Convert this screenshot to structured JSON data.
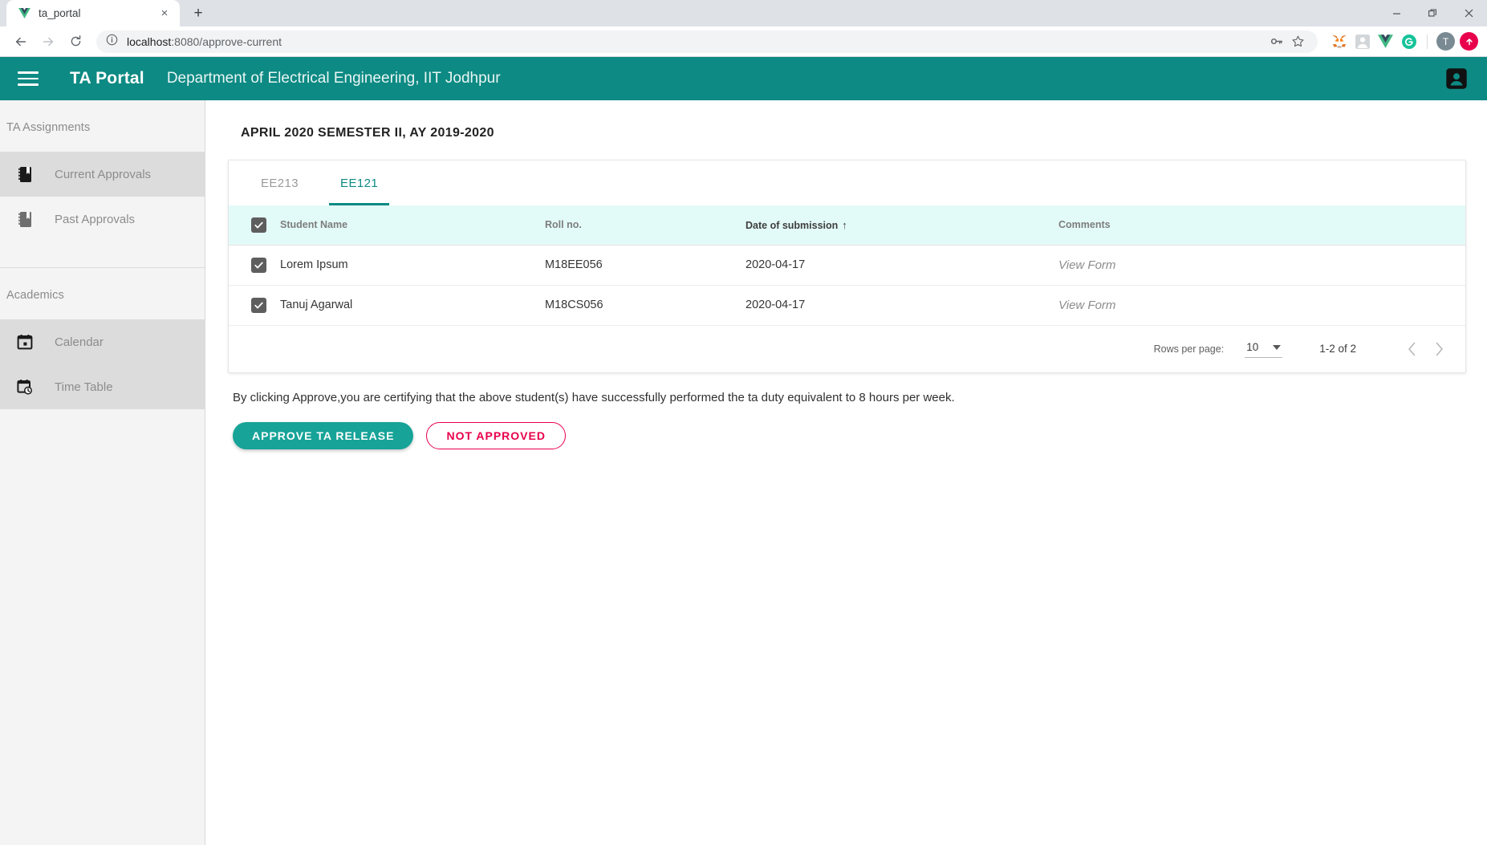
{
  "browser": {
    "tab": {
      "title": "ta_portal",
      "favicon": "vue-logo-icon",
      "close": "×"
    },
    "new_tab_label": "+",
    "window_controls": {
      "minimize": "minimize-icon",
      "maximize": "restore-icon",
      "close": "close-icon"
    },
    "nav": {
      "back": "back-arrow-icon",
      "forward": "forward-arrow-icon",
      "reload": "reload-icon"
    },
    "omnibox": {
      "info_icon": "site-info-icon",
      "url_host": "localhost",
      "url_path": ":8080/approve-current",
      "password_icon": "key-icon",
      "bookmark_icon": "star-icon"
    },
    "extensions": [
      {
        "name": "metamask-icon"
      },
      {
        "name": "extension-icon"
      },
      {
        "name": "vue-devtools-icon"
      },
      {
        "name": "grammarly-icon"
      }
    ],
    "profile_initial": "T",
    "update_icon": "update-arrow-icon"
  },
  "appbar": {
    "menu_icon": "hamburger-menu-icon",
    "title": "TA Portal",
    "subtitle": "Department of Electrical Engineering, IIT Jodhpur",
    "account_icon": "account-box-icon",
    "color": "#0d8a83"
  },
  "sidebar": {
    "sections": [
      {
        "label": "TA Assignments",
        "items": [
          {
            "label": "Current Approvals",
            "icon": "book-bookmark-icon",
            "active": true
          },
          {
            "label": "Past Approvals",
            "icon": "book-bookmark-icon",
            "active": false
          }
        ]
      },
      {
        "label": "Academics",
        "items": [
          {
            "label": "Calendar",
            "icon": "calendar-icon",
            "active": true
          },
          {
            "label": "Time Table",
            "icon": "calendar-clock-icon",
            "active": true
          }
        ]
      }
    ]
  },
  "main": {
    "page_title": "APRIL 2020 SEMESTER II, AY 2019-2020",
    "tabs": [
      {
        "label": "EE213",
        "active": false
      },
      {
        "label": "EE121",
        "active": true
      }
    ],
    "table": {
      "select_all_checked": true,
      "columns": [
        {
          "key": "name",
          "label": "Student Name",
          "sorted": false
        },
        {
          "key": "roll",
          "label": "Roll no.",
          "sorted": false
        },
        {
          "key": "date",
          "label": "Date of submission",
          "sorted": true,
          "sort_arrow": "↑"
        },
        {
          "key": "comments",
          "label": "Comments",
          "sorted": false
        }
      ],
      "rows": [
        {
          "checked": true,
          "name": "Lorem Ipsum",
          "roll": "M18EE056",
          "date": "2020-04-17",
          "comments": "View Form"
        },
        {
          "checked": true,
          "name": "Tanuj Agarwal",
          "roll": "M18CS056",
          "date": "2020-04-17",
          "comments": "View Form"
        }
      ]
    },
    "pagination": {
      "rows_per_page_label": "Rows per page:",
      "rows_per_page_value": "10",
      "range": "1-2 of 2",
      "prev_icon": "chevron-left-icon",
      "next_icon": "chevron-right-icon"
    },
    "certification_text": "By clicking Approve,you are certifying that the above student(s) have successfully performed the ta duty equivalent to 8 hours per week.",
    "buttons": {
      "approve": {
        "label": "APPROVE TA RELEASE",
        "color": "#17a398"
      },
      "reject": {
        "label": "NOT APPROVED",
        "color": "#e8004c"
      }
    }
  }
}
